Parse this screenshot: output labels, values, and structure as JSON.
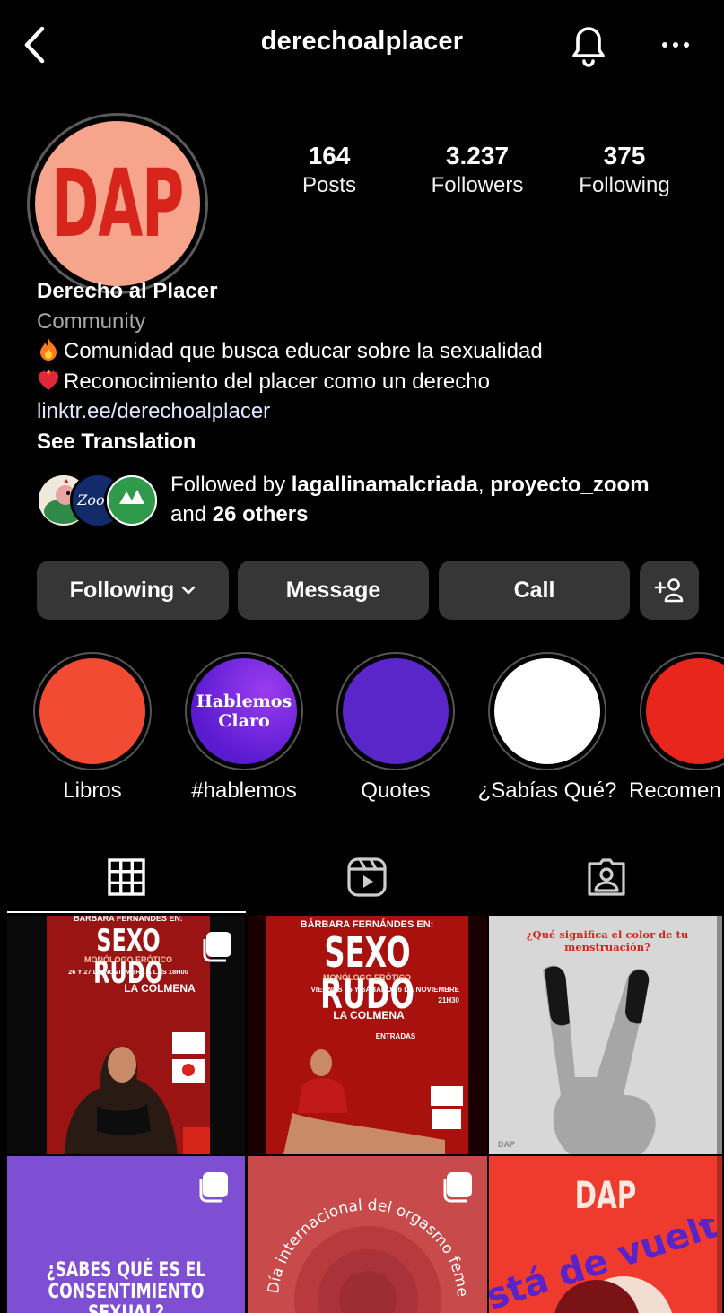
{
  "header": {
    "username": "derechoalplacer"
  },
  "profile": {
    "avatar_text": "DAP",
    "stats": {
      "posts_count": "164",
      "posts_label": "Posts",
      "followers_count": "3.237",
      "followers_label": "Followers",
      "following_count": "375",
      "following_label": "Following"
    },
    "name": "Derecho al Placer",
    "category": "Community",
    "bio_line1": "Comunidad que busca educar sobre la sexualidad",
    "bio_line2": "Reconocimiento del placer como un derecho",
    "link": "linktr.ee/derechoalplacer",
    "see_translation": "See Translation"
  },
  "followed_by": {
    "prefix": "Followed by ",
    "user1": "lagallinamalcriada",
    "separator": ", ",
    "user2": "proyecto_zoom",
    "and": "and ",
    "others": "26 others"
  },
  "actions": {
    "following": "Following",
    "message": "Message",
    "call": "Call"
  },
  "highlights": [
    {
      "label": "Libros",
      "color": "#f24b33"
    },
    {
      "label": "#hablemos",
      "color": "#6a24e0",
      "inner_line1": "Hablemos",
      "inner_line2": "Claro"
    },
    {
      "label": "Quotes",
      "color": "#5a25c9"
    },
    {
      "label": "¿Sabías Qué?",
      "color": "#ffffff"
    },
    {
      "label": "Recomen",
      "color": "#e8261b"
    }
  ],
  "posts": {
    "p1_pre": "BÁRBARA FERNÁNDES EN:",
    "p1_title": "SEXO RUDO",
    "p1_sub": "MONÓLOGO ERÓTICO",
    "p1_date": "26 Y 27 DE NOVIEMBRE A LAS 18H00",
    "p1_venue": "LA COLMENA",
    "p2_pre": "BÁRBARA FERNÁNDES EN:",
    "p2_title": "SEXO RUDO",
    "p2_sub": "MONÓLOGO ERÓTICO",
    "p2_date": "VIERNES 25 Y SÁBADO 26 DE NOVIEMBRE",
    "p2_time": "21H30",
    "p2_venue": "LA COLMENA",
    "p2_entries": "ENTRADAS",
    "p3_title": "¿Qué significa el color de tu menstruación?",
    "p3_brand": "DAP",
    "p4_title_line1": "¿SABES QUÉ ES EL",
    "p4_title_line2": "CONSENTIMIENTO SEXUAL?",
    "p5_arc": "Día internacional del orgasmo femenino",
    "p6_brand": "DAP",
    "p6_title": "Está de vuelta"
  },
  "colors": {
    "background": "#000000",
    "button_bg": "#363636",
    "link": "#dfe8ff",
    "category": "#a8a8a8",
    "avatar_bg": "#f7a48c",
    "avatar_text": "#d8251c"
  }
}
